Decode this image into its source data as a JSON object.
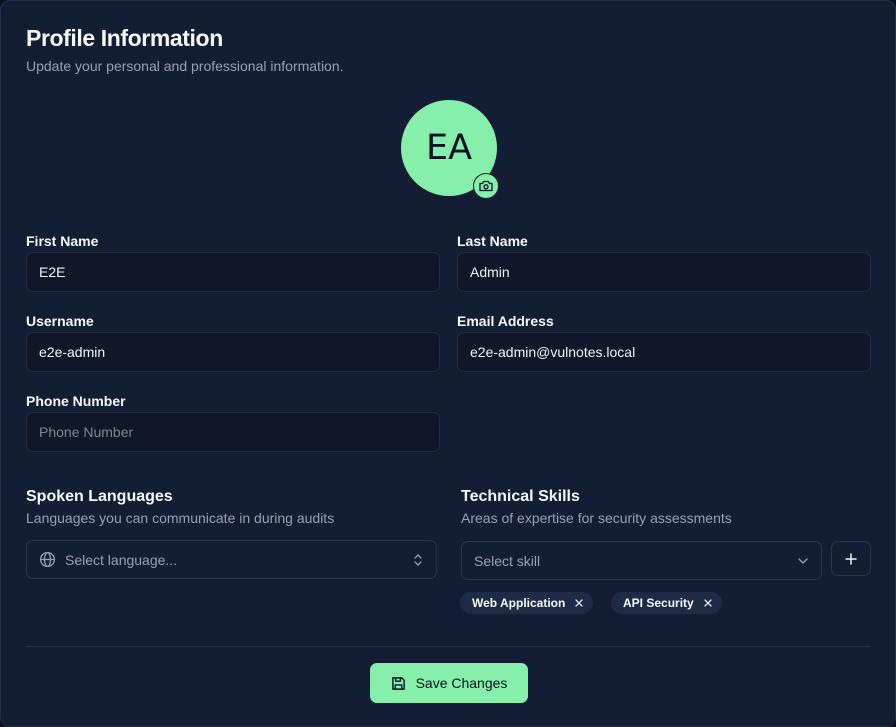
{
  "header": {
    "title": "Profile Information",
    "subtitle": "Update your personal and professional information."
  },
  "avatar": {
    "initials": "EA",
    "bg_color": "#86efac",
    "upload_icon": "camera-icon"
  },
  "fields": {
    "first_name": {
      "label": "First Name",
      "value": "E2E",
      "placeholder": ""
    },
    "last_name": {
      "label": "Last Name",
      "value": "Admin",
      "placeholder": ""
    },
    "username": {
      "label": "Username",
      "value": "e2e-admin",
      "placeholder": ""
    },
    "email": {
      "label": "Email Address",
      "value": "e2e-admin@vulnotes.local",
      "placeholder": ""
    },
    "phone": {
      "label": "Phone Number",
      "value": "",
      "placeholder": "Phone Number"
    }
  },
  "languages": {
    "title": "Spoken Languages",
    "subtitle": "Languages you can communicate in during audits",
    "select_placeholder": "Select language...",
    "icon": "globe-icon"
  },
  "skills": {
    "title": "Technical Skills",
    "subtitle": "Areas of expertise for security assessments",
    "select_placeholder": "Select skill",
    "chips": [
      "Web Application",
      "API Security"
    ]
  },
  "actions": {
    "save_label": "Save Changes",
    "save_icon": "save-icon"
  },
  "colors": {
    "accent": "#86efac",
    "background": "#131d33",
    "input_bg": "#0f1729",
    "chip_bg": "#1e2b47"
  }
}
